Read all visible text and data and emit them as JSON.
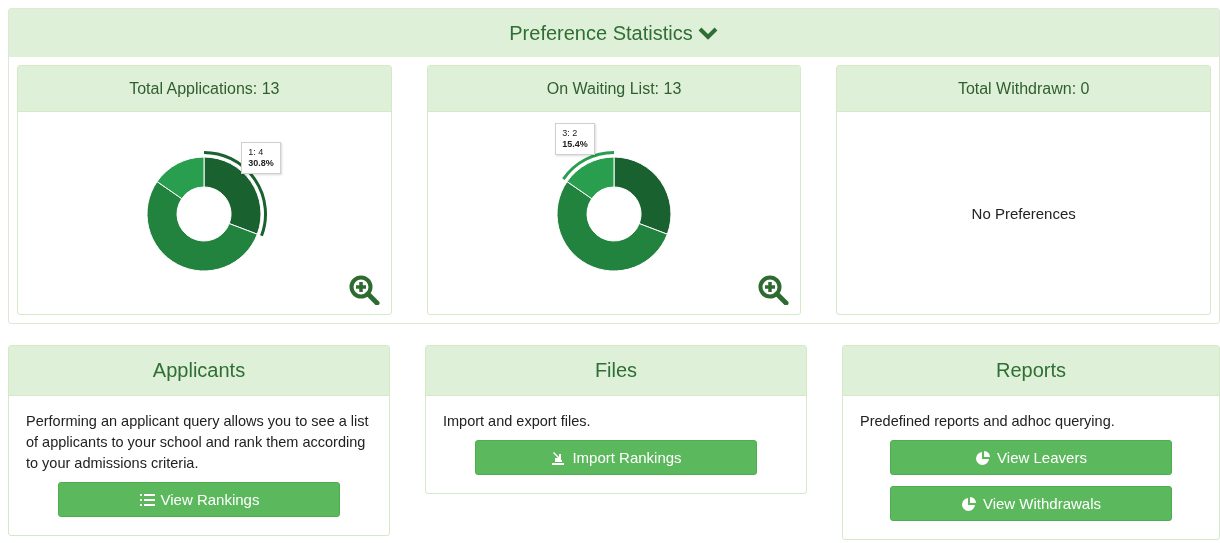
{
  "panel": {
    "title": "Preference Statistics",
    "expanded": true
  },
  "stat_cards": [
    {
      "kind": "chart",
      "title": "Total Applications: 13",
      "slices": [
        {
          "selected": true
        },
        {
          "selected": false
        },
        {
          "selected": false
        }
      ],
      "tooltip": {
        "label": "1: 4",
        "percent": "30.8%"
      }
    },
    {
      "kind": "chart",
      "title": "On Waiting List: 13",
      "slices": [
        {
          "selected": false
        },
        {
          "selected": false
        },
        {
          "selected": true
        }
      ],
      "tooltip": {
        "label": "3: 2",
        "percent": "15.4%"
      }
    },
    {
      "kind": "empty",
      "title": "Total Withdrawn: 0",
      "message": "No Preferences"
    }
  ],
  "action_cards": [
    {
      "title": "Applicants",
      "text": "Performing an applicant query allows you to see a list of applicants to your school and rank them according to your admissions criteria.",
      "buttons": [
        "View Rankings"
      ]
    },
    {
      "title": "Files",
      "text": "Import and export files.",
      "buttons": [
        "Import Rankings"
      ]
    },
    {
      "title": "Reports",
      "text": "Predefined reports and adhoc querying.",
      "buttons": [
        "View Leavers",
        "View Withdrawals"
      ]
    }
  ]
}
